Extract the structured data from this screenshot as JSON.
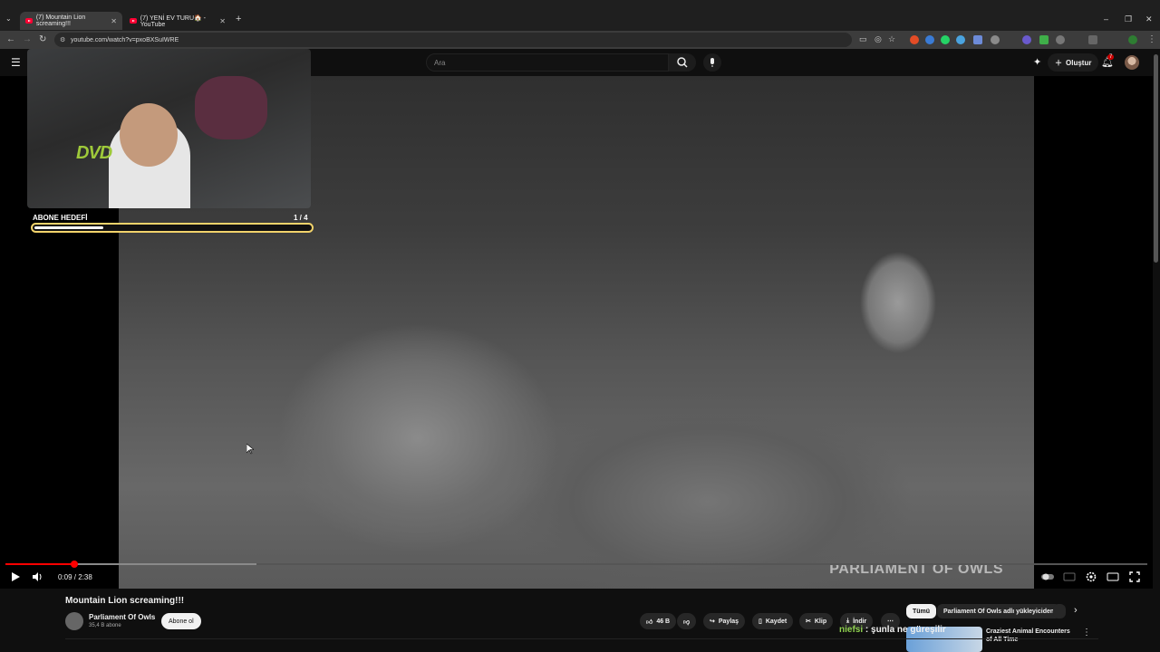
{
  "browser": {
    "tabs": [
      {
        "title": "(7) Mountain Lion screaming!!!",
        "active": true
      },
      {
        "title": "(7) YENİ EV TURU🏠 - YouTube",
        "active": false
      }
    ],
    "new_tab": "+",
    "url": "youtube.com/watch?v=pxoBXSuIWRE",
    "window_controls": [
      "–",
      "❐",
      "✕"
    ]
  },
  "youtube": {
    "search_placeholder": "Ara",
    "create_label": "Oluştur",
    "notification_count": "7"
  },
  "overlay": {
    "dvd_logo": "DVD",
    "goal_title": "ABONE HEDEFİ",
    "goal_count": "1  / 4",
    "goal_progress": 0.25
  },
  "player": {
    "watermark": "PARLIAMENT OF OWLS",
    "time": "0:09 / 2:38",
    "played_fraction": 0.06,
    "buffered_fraction": 0.22
  },
  "video": {
    "title": "Mountain Lion screaming!!!",
    "channel": "Parliament Of Owls",
    "subscribers": "35,4 B abone",
    "subscribe_label": "Abone ol",
    "likes": "46 B",
    "share": "Paylaş",
    "save": "Kaydet",
    "clip": "Klip",
    "download": "İndir"
  },
  "chips": {
    "all": "Tümü",
    "channel": "Parliament Of Owls adlı yükleyiciden"
  },
  "chat": {
    "user": "niefsi",
    "message": " : şunla ne güreşilir"
  },
  "recommendation": {
    "title": "Craziest Animal Encounters of All Time"
  },
  "colors": {
    "accent": "#ff0000",
    "goal_border": "#f2d36b",
    "dvd": "#9ec93a",
    "chat_user": "#8fd14f"
  }
}
